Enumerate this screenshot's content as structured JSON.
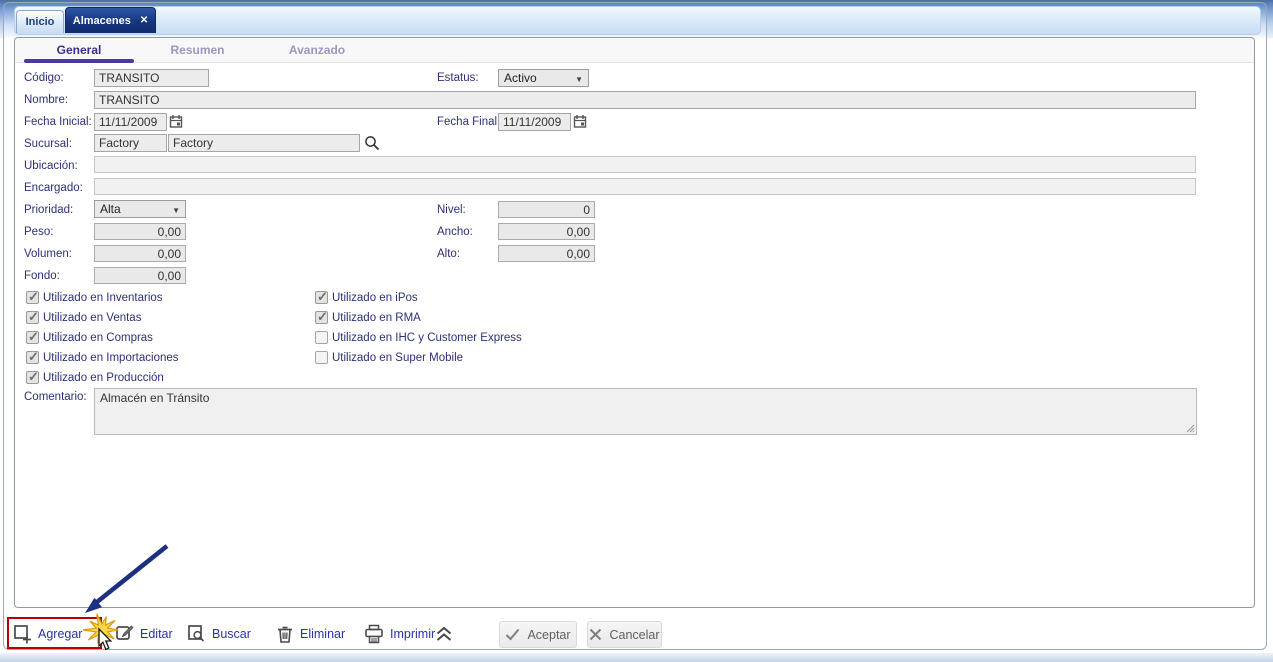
{
  "window_tabs": {
    "items": [
      {
        "label": "Inicio",
        "active": false
      },
      {
        "label": "Almacenes",
        "active": true
      }
    ],
    "close_glyph": "✕"
  },
  "subtabs": {
    "items": [
      {
        "label": "General",
        "active": true
      },
      {
        "label": "Resumen",
        "active": false
      },
      {
        "label": "Avanzado",
        "active": false
      }
    ]
  },
  "form": {
    "codigo": {
      "label": "Código:",
      "value": "TRANSITO"
    },
    "estatus": {
      "label": "Estatus:",
      "value": "Activo"
    },
    "nombre": {
      "label": "Nombre:",
      "value": "TRANSITO"
    },
    "fecha_inicial": {
      "label": "Fecha Inicial:",
      "value": "11/11/2009"
    },
    "fecha_final": {
      "label": "Fecha Final:",
      "value": "11/11/2009"
    },
    "sucursal": {
      "label": "Sucursal:",
      "code": "Factory",
      "name": "Factory"
    },
    "ubicacion": {
      "label": "Ubicación:",
      "value": ""
    },
    "encargado": {
      "label": "Encargado:",
      "value": ""
    },
    "prioridad": {
      "label": "Prioridad:",
      "value": "Alta"
    },
    "nivel": {
      "label": "Nivel:",
      "value": "0"
    },
    "peso": {
      "label": "Peso:",
      "value": "0,00"
    },
    "ancho": {
      "label": "Ancho:",
      "value": "0,00"
    },
    "volumen": {
      "label": "Volumen:",
      "value": "0,00"
    },
    "alto": {
      "label": "Alto:",
      "value": "0,00"
    },
    "fondo": {
      "label": "Fondo:",
      "value": "0,00"
    },
    "comentario": {
      "label": "Comentario:",
      "value": "Almacén en Tránsito"
    }
  },
  "usage_checkboxes": {
    "left": [
      {
        "label": "Utilizado en Inventarios",
        "checked": true
      },
      {
        "label": "Utilizado en Ventas",
        "checked": true
      },
      {
        "label": "Utilizado en Compras",
        "checked": true
      },
      {
        "label": "Utilizado en Importaciones",
        "checked": true
      },
      {
        "label": "Utilizado en Producción",
        "checked": true
      }
    ],
    "right": [
      {
        "label": "Utilizado en iPos",
        "checked": true
      },
      {
        "label": "Utilizado en RMA",
        "checked": true
      },
      {
        "label": "Utilizado en IHC y Customer Express",
        "checked": false
      },
      {
        "label": "Utilizado en Super Mobile",
        "checked": false
      }
    ]
  },
  "toolbar": {
    "buttons": [
      {
        "label": "Agregar",
        "icon": "add-document-icon",
        "highlighted": true
      },
      {
        "label": "Editar",
        "icon": "edit-document-icon",
        "highlighted": false
      },
      {
        "label": "Buscar",
        "icon": "search-document-icon",
        "highlighted": false
      },
      {
        "label": "Eliminar",
        "icon": "trash-icon",
        "highlighted": false
      },
      {
        "label": "Imprimir",
        "icon": "printer-icon",
        "highlighted": false
      }
    ],
    "collapse_icon": "chevron-double-up-icon",
    "aceptar_label": "Aceptar",
    "cancelar_label": "Cancelar"
  },
  "annotations": {
    "highlight_box_color": "#b40000",
    "arrow_color": "#1c2f80",
    "starburst_color": "#ffd84a"
  },
  "colors": {
    "active_tab_bg": "#16357d",
    "subtab_active_underline": "#4a3a9a",
    "label_text": "#2e3078",
    "toolbar_text": "#2733a6"
  }
}
